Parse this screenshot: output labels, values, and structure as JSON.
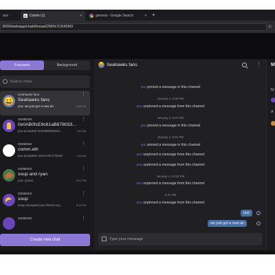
{
  "browser": {
    "tabs": [
      {
        "label": "ace ·",
        "active": false
      },
      {
        "label": "Comm (1)",
        "active": true,
        "favicon": "C"
      },
      {
        "label": "genesis - Google Search",
        "active": false
      }
    ],
    "new_tab_symbol": "+",
    "url": "3000/webapp/chat/thread/256%7C64260/"
  },
  "sidebar": {
    "segments": {
      "focused": "Focused",
      "background": "Background"
    },
    "search_placeholder": "Search chats",
    "chats": [
      {
        "name": "Seahawks fans",
        "title": "Seahawks fans",
        "preview": "you: we just got a new do",
        "time": "4:46 PM",
        "selected": true
      },
      {
        "name": "GENESIS",
        "title": "0x0AB0fcE9c61aB878033...",
        "preview": "you accepted 0x0AB0fcE9c61...",
        "time": "1:59 AM"
      },
      {
        "name": "GENESIS",
        "title": "comm.eth",
        "preview": "you accepted comm.eth's friend",
        "time": "1:46 AM"
      },
      {
        "name": "GENESIS",
        "title": "soup and ryan",
        "preview": "you: yoooo",
        "time": "8:21 PM"
      },
      {
        "name": "GENESIS",
        "title": "soup",
        "preview": "soup accepted your friend req...",
        "time": "8:19 PM"
      },
      {
        "name": "GENESIS",
        "title": "",
        "preview": "",
        "time": ""
      }
    ],
    "create_label": "Create new chat"
  },
  "thread": {
    "title": "Seahawks fans",
    "events": [
      {
        "type": "system",
        "who": "you",
        "text": "pinned a message in this channel"
      },
      {
        "type": "date",
        "text": "January 4, 9:30 PM"
      },
      {
        "type": "system",
        "who": "you",
        "text": "unpinned a message from this channel"
      },
      {
        "type": "date",
        "text": "January 4, 9:37 PM"
      },
      {
        "type": "system",
        "who": "you",
        "text": "pinned a message in this channel"
      },
      {
        "type": "date",
        "text": "January 4, 9:51 PM"
      },
      {
        "type": "system",
        "who": "you",
        "text": "pinned a message in this channel"
      },
      {
        "type": "system",
        "who": "you",
        "text": "unpinned a message from this channel"
      },
      {
        "type": "system",
        "who": "you",
        "text": "unpinned a message from this channel"
      },
      {
        "type": "date",
        "text": "January 4, 10:04 PM"
      },
      {
        "type": "system",
        "who": "you",
        "text": "unpinned a message from this channel"
      },
      {
        "type": "date",
        "text": "4:47 PM"
      },
      {
        "type": "system",
        "who": "you",
        "text": "unpinned a message from this channel"
      }
    ],
    "messages": [
      {
        "text": "test"
      },
      {
        "text": "we just got a new do"
      }
    ],
    "composer_placeholder": "Type your message"
  },
  "right_panel": {
    "heading": "M",
    "items": [
      "M",
      "A"
    ]
  },
  "colors": {
    "accent": "#8b77d6",
    "bubble": "#4a6fa5",
    "mention": "#6f71e0"
  }
}
